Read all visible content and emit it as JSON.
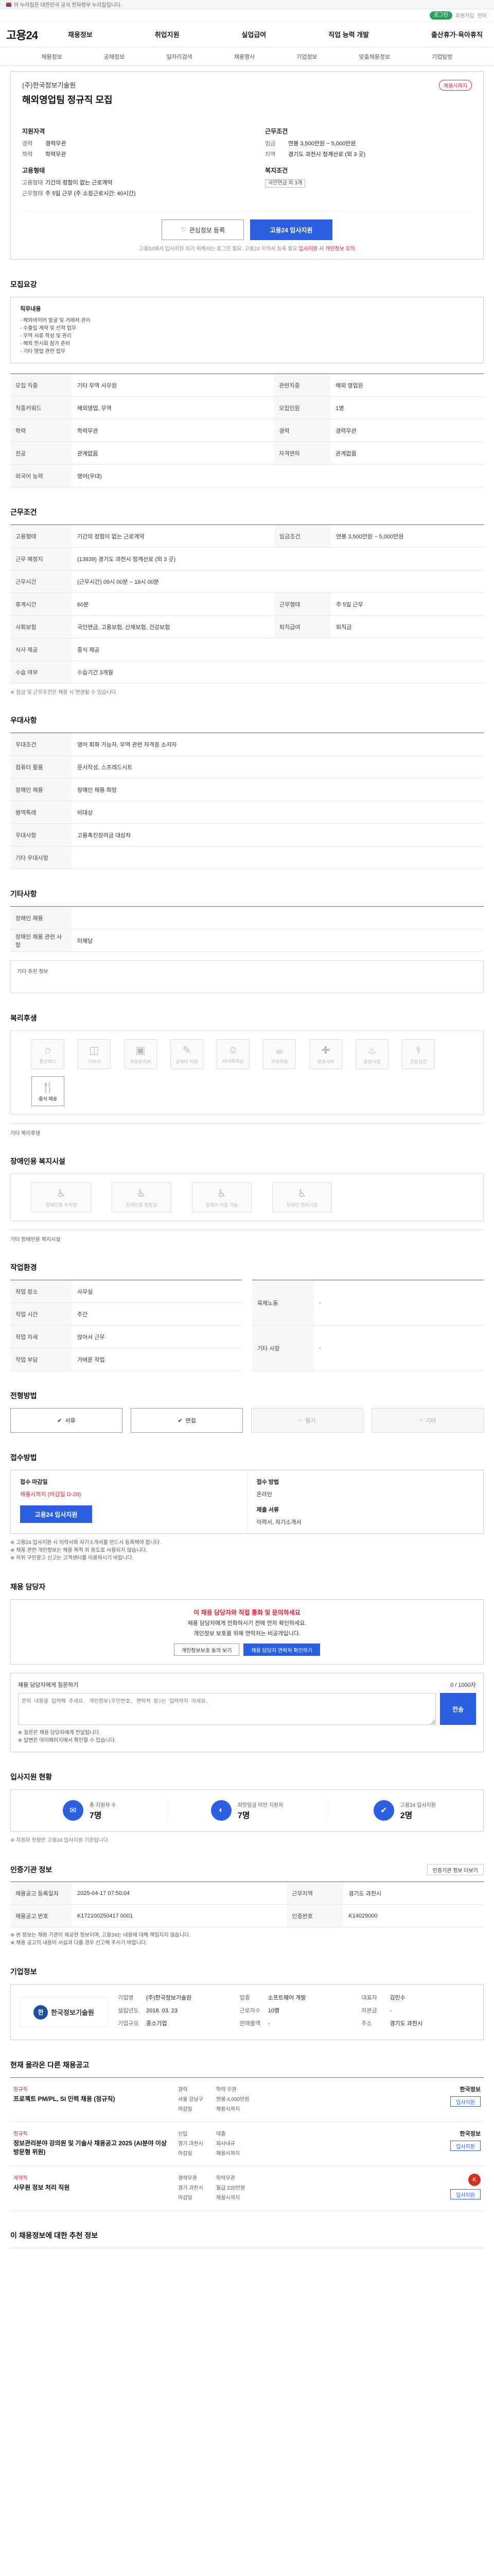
{
  "site": {
    "gov_notice": "이 누리집은 대한민국 공식 전자정부 누리집입니다.",
    "logo": "고용24",
    "login": "로그인",
    "join": "회원가입",
    "language": "언어"
  },
  "gnb": [
    "채용정보",
    "취업지원",
    "실업급여",
    "직업 능력 개발",
    "출산휴가·육아휴직"
  ],
  "snb": [
    "채용정보",
    "공채정보",
    "일자리검색",
    "채용행사",
    "기업정보",
    "맞춤채용정보",
    "기업탐방"
  ],
  "job": {
    "company": "(주)한국정보기술원",
    "title": "해외영업팀 정규직 모집",
    "dday": "채용시까지",
    "qual_h": "지원자격",
    "qual": [
      {
        "k": "경력",
        "v": "경력무관"
      },
      {
        "k": "학력",
        "v": "학력무관"
      }
    ],
    "cond_h": "근무조건",
    "cond": [
      {
        "k": "임금",
        "v": "연봉 3,500만원 ~ 5,000만원"
      },
      {
        "k": "지역",
        "v": "경기도 과천시 청계산로 (외 3 곳)"
      }
    ],
    "emp_h": "고용형태",
    "emp": [
      {
        "k": "고용형태",
        "v": "기간의 정함이 없는 근로계약"
      },
      {
        "k": "근무형태",
        "v": "주 5일 근무 (주 소정근로시간: 40시간)"
      }
    ],
    "welfare_h": "복지조건",
    "welfare_tag": "국민연금 외 3개",
    "btn_scrap": "관심정보 등록",
    "btn_apply": "고용24 입사지원",
    "head_note_a": "고용24에서 입사지원 하기 위해서는 로그인 필요. 고용24 이력서 등록 필요",
    "head_note_b": "입사지원 시 개인정보 유의"
  },
  "sections": {
    "recruit": "모집요강",
    "work": "근무조건",
    "prefer": "우대사항",
    "other": "기타사항",
    "welfare": "복리후생",
    "disabled": "장애인용 복지시설",
    "workenv": "작업환경",
    "method": "전형방법",
    "apply": "접수방법",
    "manager": "채용 담당자",
    "stats": "입사지원 현황",
    "info": "인증기관 정보",
    "corp": "기업정보",
    "list": "현재 올라온 다른 채용공고",
    "search": "이 채용정보에 대한 추천 정보"
  },
  "recruit": {
    "duty_h": "직무내용",
    "duty": [
      "- 해외바이어 발굴 및 거래처 관리",
      "- 수출입 계약 및 선적 업무",
      "- 무역 서류 작성 및 관리",
      "- 해외 전시회 참가 준비",
      "- 기타 영업 관련 업무"
    ],
    "rows": [
      {
        "k": "모집 직종",
        "v": "기타 무역 사무원",
        "k2": "관련직종",
        "v2": "해외 영업원"
      },
      {
        "k": "직종키워드",
        "v": "해외영업, 무역",
        "k2": "모집인원",
        "v2": "1명"
      },
      {
        "k": "학력",
        "v": "학력무관",
        "k2": "경력",
        "v2": "경력무관"
      },
      {
        "k": "전공",
        "v": "관계없음",
        "k2": "자격면허",
        "v2": "관계없음"
      },
      {
        "k": "외국어 능력",
        "v": "영어(우대)",
        "k2": "",
        "v2": ""
      }
    ]
  },
  "work": {
    "rows": [
      {
        "k": "고용형태",
        "v": "기간의 정함이 없는 근로계약",
        "k2": "임금조건",
        "v2": "연봉 3,500만원 ~ 5,000만원"
      },
      {
        "k": "근무 예정지",
        "v": "(13839) 경기도 과천시 청계산로 (외 3 곳)",
        "k2": "",
        "v2": ""
      },
      {
        "k": "근무시간",
        "v": "(근무시간) 09시 00분 ~ 18시 00분",
        "k2": "",
        "v2": ""
      },
      {
        "k": "휴게시간",
        "v": "60분",
        "k2": "근무형태",
        "v2": "주 5일 근무"
      },
      {
        "k": "사회보험",
        "v": "국민연금, 고용보험, 산재보험, 건강보험",
        "k2": "퇴직급여",
        "v2": "퇴직금"
      },
      {
        "k": "식사 제공",
        "v": "중식 제공",
        "k2": "",
        "v2": ""
      },
      {
        "k": "수습 여부",
        "v": "수습기간 3개월",
        "k2": "",
        "v2": ""
      }
    ],
    "note": "※ 임금 및 근무조건은 채용 시 변경될 수 있습니다."
  },
  "prefer": {
    "rows": [
      {
        "k": "우대조건",
        "v": "영어 회화 가능자, 무역 관련 자격증 소지자"
      },
      {
        "k": "컴퓨터 활용",
        "v": "문서작성, 스프레드시트"
      },
      {
        "k": "장애인 채용",
        "v": "장애인 채용 희망"
      },
      {
        "k": "병역특례",
        "v": "비대상"
      },
      {
        "k": "우대사항",
        "v": "고용촉진장려금 대상자"
      },
      {
        "k": "기타 우대사항",
        "v": ""
      }
    ]
  },
  "other": {
    "rows": [
      {
        "k": "장애인 채용",
        "v": ""
      },
      {
        "k": "장애인 채용 관련 사항",
        "v": "미해당"
      }
    ],
    "note": "기타 추천 정보"
  },
  "welfare": {
    "items": [
      {
        "icon": "⌂",
        "label": "통근버스",
        "on": false
      },
      {
        "icon": "◫",
        "label": "기숙사",
        "on": false
      },
      {
        "icon": "▣",
        "label": "차량유지비",
        "on": false
      },
      {
        "icon": "✎",
        "label": "교육비 지원",
        "on": false
      },
      {
        "icon": "☺",
        "label": "자녀학자금",
        "on": false
      },
      {
        "icon": "☕",
        "label": "주택지원",
        "on": false
      },
      {
        "icon": "✚",
        "label": "경조사비",
        "on": false
      },
      {
        "icon": "♨",
        "label": "휴양시설",
        "on": false
      },
      {
        "icon": "⚕",
        "label": "건강검진",
        "on": false
      },
      {
        "icon": "🍴",
        "label": "중식 제공",
        "on": true
      }
    ],
    "other_h": "기타 복리후생"
  },
  "disabled": {
    "items": [
      "장애인용 주차장",
      "장애인용 화장실",
      "휠체어 이동 가능",
      "장애인 편의시설"
    ],
    "other_h": "기타 장애인용 복지시설"
  },
  "workenv": {
    "rows": [
      {
        "k": "작업 장소",
        "v": "사무실"
      },
      {
        "k": "작업 시간",
        "v": "주간"
      },
      {
        "k": "작업 자세",
        "v": "앉아서 근무"
      },
      {
        "k": "작업 부담",
        "v": "가벼운 작업"
      }
    ],
    "rows2": [
      {
        "k": "육체노동",
        "v": "-"
      },
      {
        "k": "기타 사항",
        "v": "-"
      }
    ]
  },
  "method": {
    "steps": [
      {
        "label": "서류",
        "on": true
      },
      {
        "label": "면접",
        "on": true
      },
      {
        "label": "필기",
        "on": false
      },
      {
        "label": "기타",
        "on": false
      }
    ]
  },
  "apply": {
    "period_h": "접수 마감일",
    "period": "채용시까지 (마감일 D-20)",
    "way_h": "접수 방법",
    "way": "온라인",
    "docs_h": "제출 서류",
    "docs": "이력서, 자기소개서",
    "btn": "고용24 입사지원",
    "notes": [
      "※ 고용24 입사지원 시 이력서와 자기소개서를 반드시 등록해야 합니다.",
      "※ 채용 관련 개인정보는 채용 목적 외 용도로 사용되지 않습니다.",
      "※ 허위 구인광고 신고는 고객센터를 이용하시기 바랍니다."
    ]
  },
  "manager": {
    "h1": "이 채용 담당자와 직접 통화 및 문의하세요",
    "h2": "채용 담당자에게 전화하시기 전에 먼저 확인하세요.",
    "h3": "개인정보 보호를 위해 연락처는 비공개입니다.",
    "btn1": "개인정보보호 동의 보기",
    "btn2": "채용 담당자 연락처 확인하기",
    "q_title": "채용 담당자에게 질문하기",
    "q_count": "0 / 1000자",
    "q_ph": "문의 내용을 입력해 주세요. 개인정보(주민번호, 연락처 등)는 입력하지 마세요.",
    "q_send": "전송",
    "q_notes": [
      "※ 질문은 채용 담당자에게 전달됩니다.",
      "※ 답변은 마이페이지에서 확인할 수 있습니다."
    ]
  },
  "stats": {
    "items": [
      {
        "icon": "✉",
        "label": "총 지원자 수",
        "value": "7명"
      },
      {
        "icon": "◐",
        "label": "희망임금 미만 지원자",
        "value": "7명"
      },
      {
        "icon": "✔",
        "label": "고용24 입사지원",
        "value": "2명"
      }
    ],
    "note": "※ 지원자 현황은 고용24 입사지원 기준입니다."
  },
  "info": {
    "btn": "인증기관 정보 더보기",
    "rows": [
      {
        "k": "채용공고 등록일자",
        "v": "2025-04-17 07:50:04",
        "k2": "근무지역",
        "v2": "경기도 과천시"
      },
      {
        "k": "채용공고 번호",
        "v": "K172100250417 0001",
        "k2": "인증번호",
        "v2": "K14029000"
      }
    ],
    "notes": [
      "※ 본 정보는 채용 기관이 제공한 정보이며, 고용24는 내용에 대해 책임지지 않습니다.",
      "※ 채용 공고의 내용이 사실과 다를 경우 신고해 주시기 바랍니다."
    ]
  },
  "corp": {
    "logo_mark": "한",
    "logo_text": "한국정보기술원",
    "rows": [
      {
        "k": "기업명",
        "v": "(주)한국정보기술원"
      },
      {
        "k": "업종",
        "v": "소프트웨어 개발"
      },
      {
        "k": "대표자",
        "v": "김민수"
      },
      {
        "k": "설립년도",
        "v": "2018. 03. 23"
      },
      {
        "k": "근로자수",
        "v": "10명"
      },
      {
        "k": "자본금",
        "v": "-"
      },
      {
        "k": "기업규모",
        "v": "중소기업"
      },
      {
        "k": "연매출액",
        "v": "-"
      },
      {
        "k": "주소",
        "v": "경기도 과천시"
      }
    ]
  },
  "list": [
    {
      "tag": "정규직",
      "title": "프로젝트 PM/PL, SI 인력 채용 (정규직)",
      "logo": "한국정보",
      "r1": [
        "경력",
        "학력 무관"
      ],
      "r2": [
        "서울 강남구",
        "연봉 4,000만원"
      ],
      "r3": [
        "마감일",
        "채용시까지"
      ],
      "btn": "입사지원"
    },
    {
      "tag": "정규직",
      "title": "정보관리분야 강의원 및 기술사 채용공고 2025 (AI분야 이상 방문형 위원)",
      "logo": "한국정보",
      "r1": [
        "신입",
        "대졸"
      ],
      "r2": [
        "경기 과천시",
        "회사내규"
      ],
      "r3": [
        "마감일",
        "채용시까지"
      ],
      "btn": "입사지원"
    },
    {
      "tag": "계약직",
      "title": "사무원 정보 처리 직원",
      "logo": "K",
      "r1": [
        "경력무관",
        "학력무관"
      ],
      "r2": [
        "경기 과천시",
        "월급 220만원"
      ],
      "r3": [
        "마감일",
        "채용시까지"
      ],
      "btn": "입사지원"
    }
  ]
}
